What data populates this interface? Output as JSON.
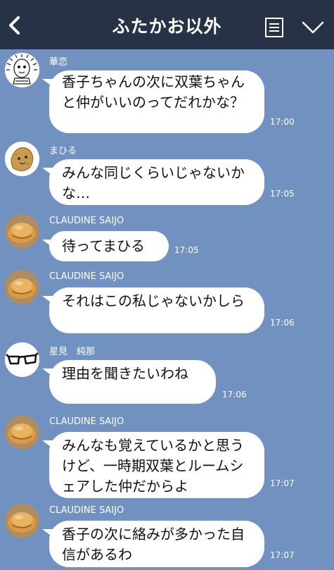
{
  "header": {
    "title": "ふたかお以外",
    "back_icon": "chevron-left-icon",
    "menu_icon": "list-document-icon",
    "collapse_icon": "chevron-down-icon"
  },
  "colors": {
    "background": "#7191c1",
    "header": "#283247",
    "bubble": "#ffffff"
  },
  "messages": [
    {
      "sender": "華恋",
      "text": "香子ちゃんの次に双葉ちゃんと仲がいいのってだれかな？",
      "time": "17:00",
      "avatar": "doodle-face-avatar"
    },
    {
      "sender": "まひる",
      "text": "みんな同じくらいじゃないかな…",
      "time": "17:05",
      "avatar": "potato-avatar"
    },
    {
      "sender": "CLAUDINE SAIJO",
      "text": "待ってまひる",
      "time": "17:05",
      "avatar": "bread-avatar"
    },
    {
      "sender": "CLAUDINE SAIJO",
      "text": "それはこの私じゃないかしら",
      "time": "17:06",
      "avatar": "bread-avatar"
    },
    {
      "sender": "星見　純那",
      "text": "理由を聞きたいわね",
      "time": "17:06",
      "avatar": "glasses-avatar"
    },
    {
      "sender": "CLAUDINE SAIJO",
      "text": "みんなも覚えているかと思うけど、一時期双葉とルームシェアした仲だからよ",
      "time": "17:07",
      "avatar": "bread-avatar"
    },
    {
      "sender": "CLAUDINE SAIJO",
      "text": "香子の次に絡みが多かった自信があるわ",
      "time": "17:07",
      "avatar": "bread-avatar"
    }
  ]
}
